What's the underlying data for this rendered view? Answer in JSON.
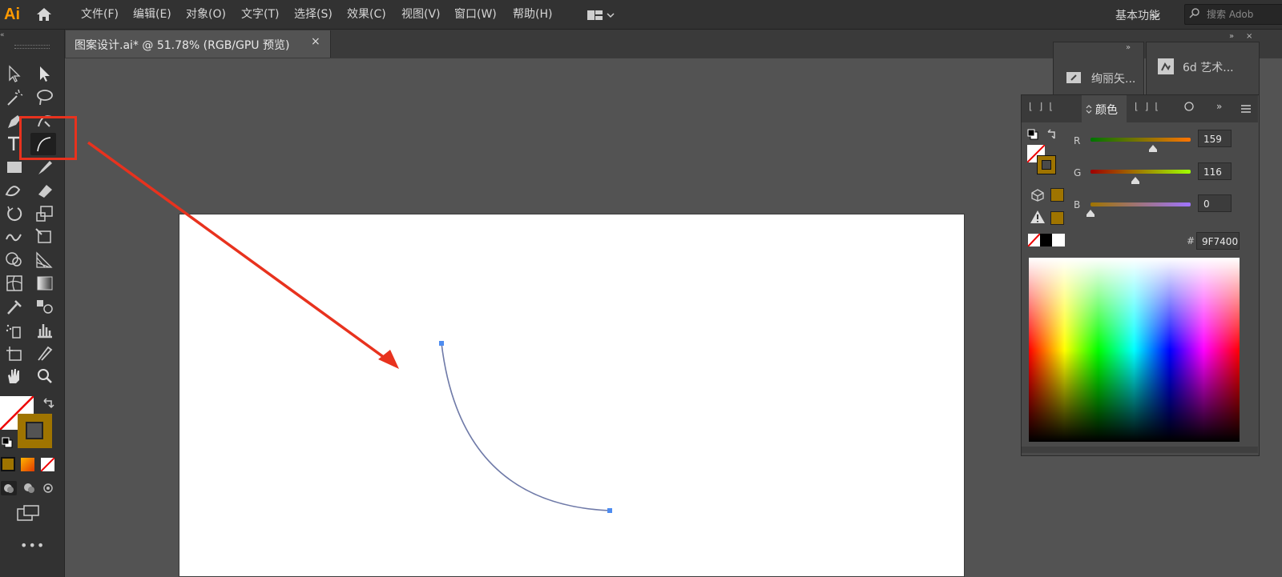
{
  "app": {
    "logo": "Ai"
  },
  "menu": {
    "items": [
      "文件(F)",
      "编辑(E)",
      "对象(O)",
      "文字(T)",
      "选择(S)",
      "效果(C)",
      "视图(V)",
      "窗口(W)",
      "帮助(H)"
    ],
    "workspace": "基本功能",
    "search_placeholder": "搜索 Adob"
  },
  "document": {
    "tab_title": "图案设计.ai* @ 51.78% (RGB/GPU 预览)",
    "close": "×"
  },
  "panels": {
    "panel_a_label": "绚丽矢...",
    "panel_b_label": "6d 艺术...",
    "color_tab": "颜色"
  },
  "color": {
    "r_label": "R",
    "g_label": "G",
    "b_label": "B",
    "r": "159",
    "g": "116",
    "b": "0",
    "r_fraction": 0.62,
    "g_fraction": 0.45,
    "b_fraction": 0.0,
    "hash": "#",
    "hex": "9F7400",
    "fill_color": "#9F7400",
    "highlight_color": "#e8321e",
    "path_color": "#6f7aa8"
  },
  "icons": [
    "home-icon",
    "selection-tool-icon",
    "direct-selection-tool-icon",
    "magic-wand-icon",
    "lasso-icon",
    "pen-tool-icon",
    "curvature-tool-icon",
    "type-tool-icon",
    "arc-tool-icon",
    "rectangle-tool-icon",
    "paintbrush-icon",
    "shaper-icon",
    "eraser-icon",
    "rotate-icon",
    "scale-icon",
    "warp-icon",
    "free-transform-icon",
    "shape-builder-icon",
    "perspective-grid-icon",
    "mesh-icon",
    "gradient-icon",
    "eyedropper-icon",
    "blend-icon",
    "symbol-sprayer-icon",
    "column-graph-icon",
    "artboard-tool-icon",
    "slice-icon",
    "hand-icon",
    "zoom-icon",
    "swap-icon"
  ]
}
